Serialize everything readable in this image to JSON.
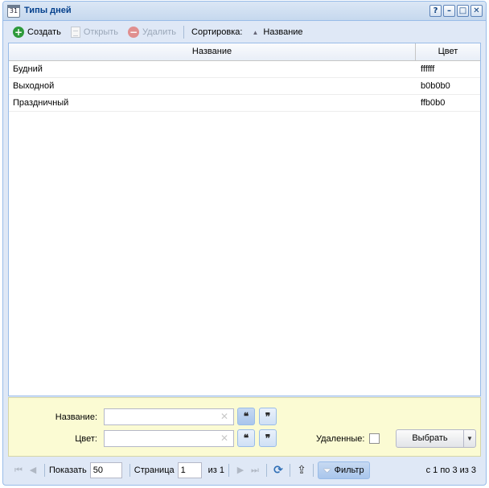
{
  "window": {
    "title": "Типы дней",
    "icon_day": "31",
    "tools": [
      "?",
      "–",
      "□",
      "✕"
    ]
  },
  "toolbar": {
    "create": "Создать",
    "open": "Открыть",
    "delete": "Удалить",
    "sort_label": "Сортировка:",
    "sort_field": "Название"
  },
  "grid": {
    "columns": [
      "Название",
      "Цвет"
    ],
    "rows": [
      {
        "name": "Будний",
        "color": "ffffff"
      },
      {
        "name": "Выходной",
        "color": "b0b0b0"
      },
      {
        "name": "Праздничный",
        "color": "ffb0b0"
      }
    ]
  },
  "filter": {
    "name_label": "Название:",
    "name_value": "",
    "color_label": "Цвет:",
    "color_value": "",
    "quote_open": "❝",
    "quote_close": "❞",
    "deleted_label": "Удаленные:",
    "select_button": "Выбрать"
  },
  "pager": {
    "show_label": "Показать",
    "page_size": "50",
    "page_label": "Страница",
    "page": "1",
    "of": "из 1",
    "filter_button": "Фильтр",
    "info": "с 1 по 3 из 3"
  },
  "colors": {
    "accent": "#99bce8",
    "title_text": "#04408c",
    "filter_bg": "#fbfbd3"
  }
}
